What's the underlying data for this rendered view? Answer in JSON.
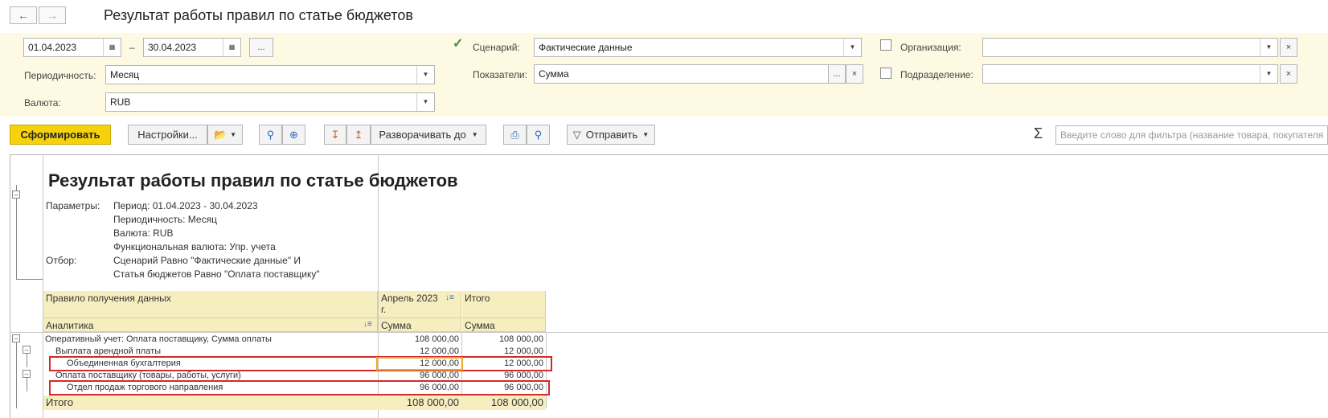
{
  "header": {
    "back_icon": "arrow-left-icon",
    "forward_icon": "arrow-right-icon",
    "title": "Результат работы правил по статье бюджетов"
  },
  "filters": {
    "date_from": "01.04.2023",
    "date_sep": "–",
    "date_to": "30.04.2023",
    "period_btn": "...",
    "periodicity_label": "Периодичность:",
    "periodicity_value": "Месяц",
    "currency_label": "Валюта:",
    "currency_value": "RUB",
    "scenario_label": "Сценарий:",
    "scenario_value": "Фактические данные",
    "scenario_checked": true,
    "indicators_label": "Показатели:",
    "indicators_value": "Сумма",
    "org_label": "Организация:",
    "org_value": "",
    "dept_label": "Подразделение:",
    "dept_value": "",
    "dots": "...",
    "clear": "×"
  },
  "toolbar": {
    "generate": "Сформировать",
    "settings": "Настройки...",
    "expand_to": "Разворачивать до",
    "send": "Отправить",
    "sigma": "Σ",
    "search_placeholder": "Введите слово для фильтра (название товара, покупателя"
  },
  "report": {
    "title": "Результат работы правил по статье бюджетов",
    "params_label": "Параметры:",
    "params": [
      "Период: 01.04.2023 - 30.04.2023",
      "Периодичность: Месяц",
      "Валюта: RUB",
      "Функциональная валюта: Упр. учета"
    ],
    "filter_label": "Отбор:",
    "filters": [
      "Сценарий Равно \"Фактические данные\" И",
      "Статья бюджетов Равно \"Оплата поставщику\""
    ],
    "col_rule": "Правило получения данных",
    "col_analytics": "Аналитика",
    "col_april": "Апрель 2023",
    "col_april_2": "г.",
    "col_total": "Итого",
    "col_sum": "Сумма",
    "rows": [
      {
        "label": "Оперативный учет: Оплата поставщику, Сумма оплаты",
        "april": "108 000,00",
        "total": "108 000,00"
      },
      {
        "label": "Выплата арендной платы",
        "april": "12 000,00",
        "total": "12 000,00"
      },
      {
        "label": "Объединенная бухгалтерия",
        "april": "12 000,00",
        "total": "12 000,00"
      },
      {
        "label": "Оплата поставщику (товары, работы, услуги)",
        "april": "96 000,00",
        "total": "96 000,00"
      },
      {
        "label": "Отдел продаж торгового направления",
        "april": "96 000,00",
        "total": "96 000,00"
      }
    ],
    "total_label": "Итого",
    "total_april": "108 000,00",
    "total_total": "108 000,00"
  }
}
